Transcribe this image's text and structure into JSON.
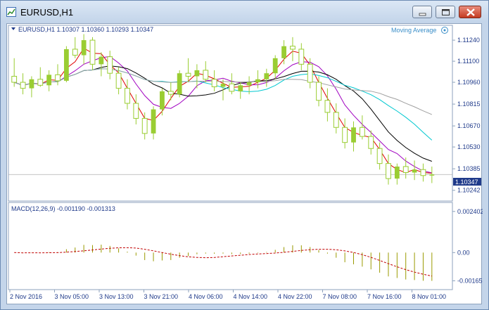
{
  "window": {
    "title": "EURUSD,H1"
  },
  "info": {
    "label": "EURUSD,H1  1.10307 1.10360 1.10293 1.10347",
    "indicator": "Moving Average"
  },
  "macd": {
    "label": "MACD(12,26,9) -0.001190 -0.001313"
  },
  "price_axis": [
    "1.11240",
    "1.11100",
    "1.10960",
    "1.10815",
    "1.10670",
    "1.10530",
    "1.10385",
    "1.10242"
  ],
  "current_price": "1.10347",
  "macd_axis": [
    "0.002402",
    "0.00",
    "-0.00165"
  ],
  "time_axis": [
    "2 Nov 2016",
    "3 Nov 05:00",
    "3 Nov 13:00",
    "3 Nov 21:00",
    "4 Nov 06:00",
    "4 Nov 14:00",
    "4 Nov 22:00",
    "7 Nov 08:00",
    "7 Nov 16:00",
    "8 Nov 01:00"
  ],
  "colors": {
    "bull": "#9acd32",
    "bear": "#9acd32",
    "ma_red": "#e00000",
    "ma_purple": "#a000c0",
    "ma_black": "#000000",
    "ma_cyan": "#00c8d0",
    "ma_gray": "#a0a0a0",
    "macd_hist": "#9a9a00",
    "macd_signal": "#c00000",
    "axis_text": "#1f3a8a"
  },
  "chart_data": {
    "type": "candlestick",
    "symbol": "EURUSD",
    "timeframe": "H1",
    "ylim": [
      1.10242,
      1.113
    ],
    "candles": [
      [
        1.11,
        1.1112,
        1.1093,
        1.1096
      ],
      [
        1.1096,
        1.1102,
        1.1088,
        1.1092
      ],
      [
        1.1092,
        1.11,
        1.1086,
        1.1098
      ],
      [
        1.1098,
        1.1106,
        1.1093,
        1.1094
      ],
      [
        1.1094,
        1.1104,
        1.109,
        1.1101
      ],
      [
        1.1101,
        1.1108,
        1.1094,
        1.1097
      ],
      [
        1.1097,
        1.112,
        1.1096,
        1.1118
      ],
      [
        1.1118,
        1.1126,
        1.1112,
        1.1114
      ],
      [
        1.1114,
        1.1128,
        1.1108,
        1.1124
      ],
      [
        1.1124,
        1.1126,
        1.1104,
        1.1108
      ],
      [
        1.1108,
        1.1116,
        1.11,
        1.1113
      ],
      [
        1.1113,
        1.1117,
        1.1098,
        1.1102
      ],
      [
        1.1102,
        1.1106,
        1.1088,
        1.1092
      ],
      [
        1.1092,
        1.1098,
        1.1078,
        1.1082
      ],
      [
        1.1082,
        1.1088,
        1.1068,
        1.1072
      ],
      [
        1.1072,
        1.1076,
        1.1058,
        1.1062
      ],
      [
        1.1062,
        1.108,
        1.1058,
        1.1078
      ],
      [
        1.1078,
        1.1092,
        1.1074,
        1.109
      ],
      [
        1.109,
        1.1096,
        1.1084,
        1.1088
      ],
      [
        1.1088,
        1.1104,
        1.1086,
        1.1102
      ],
      [
        1.1102,
        1.1112,
        1.1096,
        1.11
      ],
      [
        1.11,
        1.1108,
        1.1092,
        1.1104
      ],
      [
        1.1104,
        1.111,
        1.1096,
        1.1098
      ],
      [
        1.1098,
        1.1104,
        1.109,
        1.1093
      ],
      [
        1.1093,
        1.1098,
        1.1084,
        1.1095
      ],
      [
        1.1095,
        1.1102,
        1.1088,
        1.109
      ],
      [
        1.109,
        1.1096,
        1.1085,
        1.1094
      ],
      [
        1.1094,
        1.11,
        1.1088,
        1.1096
      ],
      [
        1.1096,
        1.1104,
        1.1092,
        1.1098
      ],
      [
        1.1098,
        1.1105,
        1.1093,
        1.1102
      ],
      [
        1.1102,
        1.1114,
        1.1098,
        1.1112
      ],
      [
        1.1112,
        1.1124,
        1.1108,
        1.112
      ],
      [
        1.112,
        1.1126,
        1.111,
        1.1118
      ],
      [
        1.1118,
        1.1122,
        1.1104,
        1.1108
      ],
      [
        1.1108,
        1.1112,
        1.1092,
        1.1096
      ],
      [
        1.1096,
        1.11,
        1.108,
        1.1084
      ],
      [
        1.1084,
        1.1092,
        1.107,
        1.1076
      ],
      [
        1.1076,
        1.1082,
        1.1062,
        1.1066
      ],
      [
        1.1066,
        1.1072,
        1.1052,
        1.1056
      ],
      [
        1.1056,
        1.107,
        1.105,
        1.1066
      ],
      [
        1.1066,
        1.1074,
        1.1058,
        1.106
      ],
      [
        1.106,
        1.1064,
        1.1048,
        1.1052
      ],
      [
        1.1052,
        1.1056,
        1.1038,
        1.1042
      ],
      [
        1.1042,
        1.1048,
        1.1028,
        1.1032
      ],
      [
        1.1032,
        1.1042,
        1.1028,
        1.104
      ],
      [
        1.104,
        1.1046,
        1.1032,
        1.1036
      ],
      [
        1.1036,
        1.1044,
        1.1031,
        1.1038
      ],
      [
        1.1038,
        1.1042,
        1.103,
        1.1034
      ],
      [
        1.1034,
        1.104,
        1.1029,
        1.10347
      ]
    ],
    "series_labels": [
      "Moving Average"
    ]
  }
}
